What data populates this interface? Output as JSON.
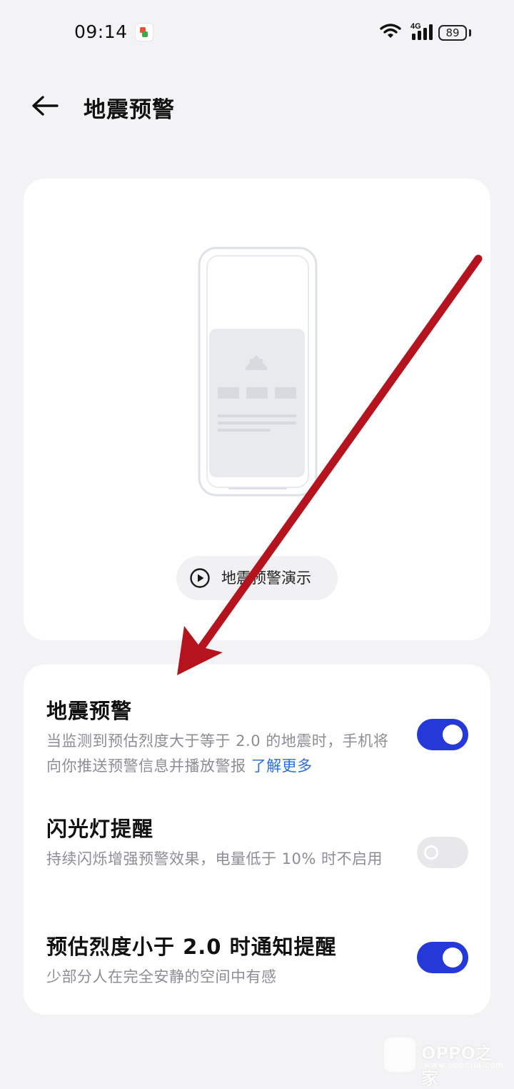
{
  "status_bar": {
    "time": "09:14",
    "network": "4G",
    "battery": "89"
  },
  "header": {
    "title": "地震预警"
  },
  "hero": {
    "demo_label": "地震预警演示"
  },
  "settings": [
    {
      "title": "地震预警",
      "desc": "当监测到预估烈度大于等于 2.0 的地震时，手机将向你推送预警信息并播放警报",
      "link": "了解更多",
      "enabled": true
    },
    {
      "title": "闪光灯提醒",
      "desc": "持续闪烁增强预警效果，电量低于 10% 时不启用",
      "enabled": false
    },
    {
      "title": "预估烈度小于 2.0 时通知提醒",
      "desc": "少部分人在完全安静的空间中有感",
      "enabled": true
    }
  ],
  "watermark": {
    "brand": "OPPO之家",
    "url": "www.oppojia.com"
  },
  "colors": {
    "accent": "#2539d8",
    "link": "#2b6fe0",
    "annotation_arrow": "#b5141e",
    "background": "#f3f3f5"
  }
}
